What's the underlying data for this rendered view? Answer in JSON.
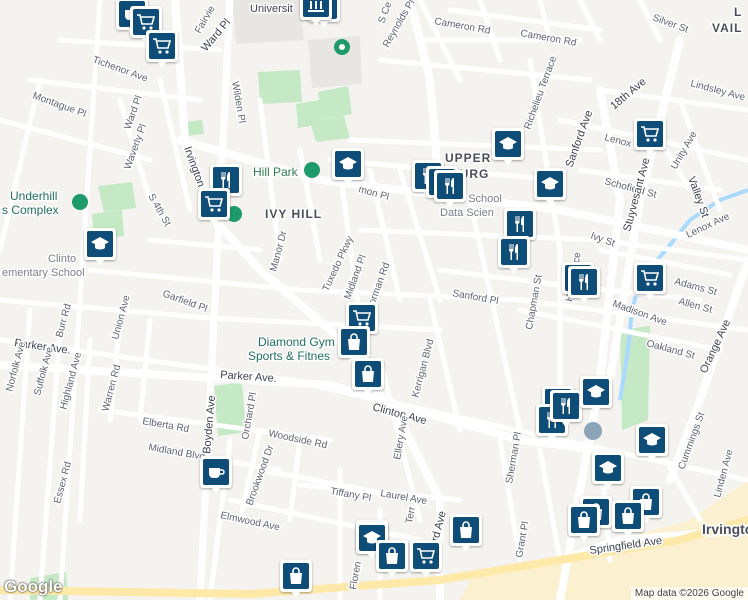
{
  "map": {
    "attribution": "Map data ©2026 Google",
    "logo": "Google",
    "colors": {
      "background": "#f4f3f0",
      "road": "#ffffff",
      "park": "#c5e8c5",
      "water": "#aadaff",
      "marker": "#0d4d78",
      "highway": "#ffe9a8"
    }
  },
  "labels": {
    "university": "Universit",
    "cameron_rd_1": "Cameron Rd",
    "cameron_rd_2": "Cameron Rd",
    "reynolds_pl": "Reynolds Pl",
    "silver_st": "Silver St",
    "lower_vailsburg_1": "L",
    "lower_vailsburg_2": "VAIL",
    "ward_pl_1": "Ward Pl",
    "tichenor_ave": "Tichenor Ave",
    "montague_pl": "Montague Pl",
    "ward_pl_2": "Ward Pl",
    "waverly_pl": "Waverly Pl",
    "wilden_pl": "Wilden Pl",
    "lindsley_ave": "Lindsley Ave",
    "eighteenth_ave": "18th Ave",
    "sanford_ave_1": "Sanford Ave",
    "lenox_st": "Lenox St",
    "richelieu_terrace": "Richelieu Terrace",
    "valley_st": "Valley St",
    "upper_1": "UPPER",
    "upper_2": "BURG",
    "ivy_hill_park": "Hill Park",
    "union_pl": "mon Pl",
    "schofield_st": "Schofield St",
    "unity_ave": "Unity Ave",
    "stuyvesant_ave": "Stuyvesant Ave",
    "underhill_1": "Underhill",
    "underhill_2": "s Complex",
    "irvington_ave": "Irvington",
    "s_4th_st": "S 4th St",
    "ivy_hill": "IVY HILL",
    "school_1": "rk School",
    "school_2": "Data Scien",
    "ivy_st": "Ivy St",
    "lenox_ave": "Lenox Ave",
    "clinton_1": "Clinto",
    "clinton_2": "ementary School",
    "manor_dr": "Manor Dr",
    "tuxedo_pkwy": "Tuxedo Pkwy",
    "midland_pl": "Midland Pl",
    "norman_rd": "Norman Rd",
    "adams_st": "Adams St",
    "allen_st": "Allen St",
    "chapman_st": "Chapman St",
    "hill_terrace": "Hill Terrace",
    "sanford_pl": "Sanford Pl",
    "madison_ave": "Madison Ave",
    "garfield_pl": "Garfield Pl",
    "burr_rd": "Burr Rd",
    "union_ave": "Union Ave",
    "oakland_st": "Oakland St",
    "orange_ave": "Orange Ave",
    "parker_ave_1": "Parker Ave.",
    "parker_ave_2": "Parker Ave.",
    "diamond_1": "Diamond Gym",
    "diamond_2": "Sports & Fitnes",
    "norfolk_ave": "Norfolk Ave",
    "suffolk_ave": "Suffolk Ave",
    "highland_ave": "Highland Ave",
    "warren_rd": "Warren Rd",
    "kerrigan_blvd": "Kerrigan Blvd",
    "clinton_ave": "Clinton Ave",
    "elberta_rd": "Elberta Rd",
    "orchard_pl": "Orchard Pl",
    "woodside_rd": "Woodside Rd",
    "midland_blvd": "Midland Blvd",
    "boyden_ave": "Boyden Ave",
    "ellery_ave": "Ellery Ave",
    "sherman_pl": "Sherman Pl",
    "cummings_st": "Cummings St",
    "linden_ave": "Linden Ave",
    "brookwood_dr": "Brookwood Dr",
    "essex_rd": "Essex Rd",
    "tiffany_pl": "Tiffany Pl",
    "laurel_ave": "Laurel Ave",
    "elmwood_ave": "Elmwood Ave",
    "grant_pl": "Grant Pl",
    "irvington": "Irvingto",
    "springfield_ave": "Springfield Ave",
    "florence": "Floren",
    "terr": "Terr",
    "rd_ave": "rd Ave",
    "fairview": "Fairvie",
    "scer": "S Ce",
    "park_1": "Park"
  },
  "markers": [
    {
      "type": "restaurant",
      "icon": "fork-knife-icon"
    },
    {
      "type": "cafe",
      "icon": "coffee-cup-icon"
    },
    {
      "type": "grocery",
      "icon": "shopping-cart-icon"
    },
    {
      "type": "grocery",
      "icon": "shopping-cart-icon"
    },
    {
      "type": "university",
      "icon": "university-icon"
    },
    {
      "type": "school",
      "icon": "graduation-cap-icon"
    },
    {
      "type": "school",
      "icon": "graduation-cap-icon"
    },
    {
      "type": "restaurant",
      "icon": "fork-knife-icon"
    },
    {
      "type": "grocery",
      "icon": "shopping-cart-icon"
    },
    {
      "type": "restaurant",
      "icon": "fork-knife-icon"
    },
    {
      "type": "restaurant",
      "icon": "fork-knife-icon"
    },
    {
      "type": "restaurant",
      "icon": "fork-knife-icon"
    },
    {
      "type": "school",
      "icon": "graduation-cap-icon"
    },
    {
      "type": "school",
      "icon": "graduation-cap-icon"
    },
    {
      "type": "restaurant",
      "icon": "fork-knife-icon"
    },
    {
      "type": "restaurant",
      "icon": "fork-knife-icon"
    },
    {
      "type": "grocery",
      "icon": "shopping-cart-icon"
    },
    {
      "type": "grocery",
      "icon": "shopping-cart-icon"
    },
    {
      "type": "restaurant",
      "icon": "fork-knife-icon"
    },
    {
      "type": "restaurant",
      "icon": "fork-knife-icon"
    },
    {
      "type": "grocery",
      "icon": "shopping-cart-icon"
    },
    {
      "type": "shop",
      "icon": "shopping-bag-icon"
    },
    {
      "type": "shop",
      "icon": "shopping-bag-icon"
    },
    {
      "type": "restaurant",
      "icon": "fork-knife-icon"
    },
    {
      "type": "restaurant",
      "icon": "fork-knife-icon"
    },
    {
      "type": "school",
      "icon": "graduation-cap-icon"
    },
    {
      "type": "school",
      "icon": "graduation-cap-icon"
    },
    {
      "type": "school",
      "icon": "graduation-cap-icon"
    },
    {
      "type": "cafe",
      "icon": "coffee-cup-icon"
    },
    {
      "type": "shop",
      "icon": "shopping-bag-icon"
    },
    {
      "type": "shop",
      "icon": "shopping-bag-icon"
    },
    {
      "type": "shop",
      "icon": "shopping-bag-icon"
    },
    {
      "type": "shop",
      "icon": "shopping-bag-icon"
    },
    {
      "type": "school",
      "icon": "graduation-cap-icon"
    },
    {
      "type": "shop",
      "icon": "shopping-bag-icon"
    },
    {
      "type": "grocery",
      "icon": "shopping-cart-icon"
    },
    {
      "type": "shop",
      "icon": "shopping-bag-icon"
    },
    {
      "type": "shop",
      "icon": "shopping-bag-icon"
    },
    {
      "type": "shop",
      "icon": "shopping-bag-icon"
    },
    {
      "type": "shop",
      "icon": "shopping-bag-icon"
    }
  ]
}
